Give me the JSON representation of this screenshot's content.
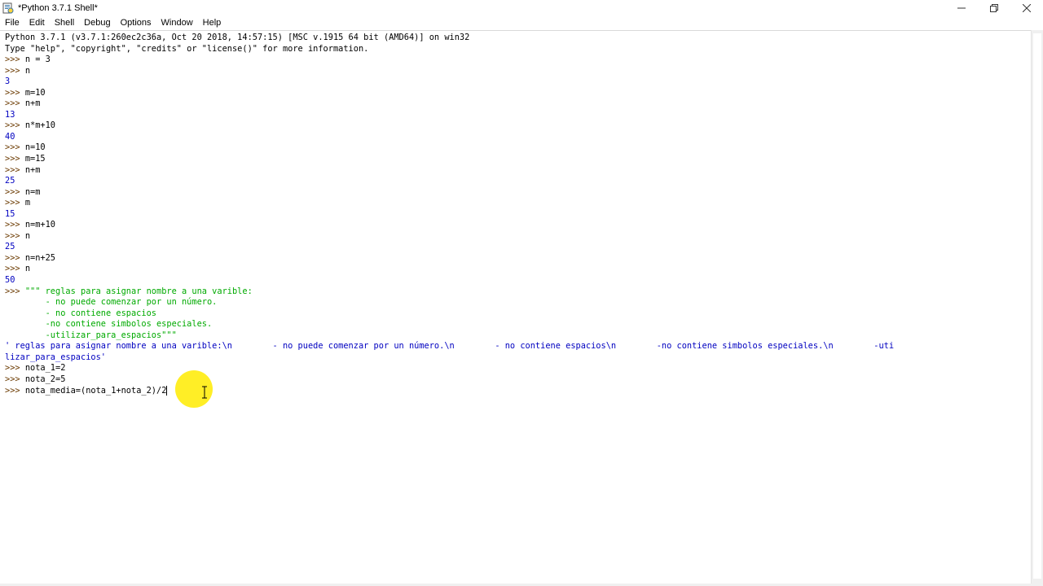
{
  "window": {
    "title": "*Python 3.7.1 Shell*",
    "controls": [
      "minimize",
      "restore",
      "close"
    ]
  },
  "menu": [
    "File",
    "Edit",
    "Shell",
    "Debug",
    "Options",
    "Window",
    "Help"
  ],
  "shell_lines": [
    {
      "t": "plain",
      "p": "",
      "c": "Python 3.7.1 (v3.7.1:260ec2c36a, Oct 20 2018, 14:57:15) [MSC v.1915 64 bit (AMD64)] on win32"
    },
    {
      "t": "plain",
      "p": "",
      "c": "Type \"help\", \"copyright\", \"credits\" or \"license()\" for more information."
    },
    {
      "t": "in",
      "p": ">>> ",
      "c": "n = 3"
    },
    {
      "t": "in",
      "p": ">>> ",
      "c": "n"
    },
    {
      "t": "out",
      "p": "",
      "c": "3"
    },
    {
      "t": "in",
      "p": ">>> ",
      "c": "m=10"
    },
    {
      "t": "in",
      "p": ">>> ",
      "c": "n+m"
    },
    {
      "t": "out",
      "p": "",
      "c": "13"
    },
    {
      "t": "in",
      "p": ">>> ",
      "c": "n*m+10"
    },
    {
      "t": "out",
      "p": "",
      "c": "40"
    },
    {
      "t": "in",
      "p": ">>> ",
      "c": "n=10"
    },
    {
      "t": "in",
      "p": ">>> ",
      "c": "m=15"
    },
    {
      "t": "in",
      "p": ">>> ",
      "c": "n+m"
    },
    {
      "t": "out",
      "p": "",
      "c": "25"
    },
    {
      "t": "in",
      "p": ">>> ",
      "c": "n=m"
    },
    {
      "t": "in",
      "p": ">>> ",
      "c": "m"
    },
    {
      "t": "out",
      "p": "",
      "c": "15"
    },
    {
      "t": "in",
      "p": ">>> ",
      "c": "n=m+10"
    },
    {
      "t": "in",
      "p": ">>> ",
      "c": "n"
    },
    {
      "t": "out",
      "p": "",
      "c": "25"
    },
    {
      "t": "in",
      "p": ">>> ",
      "c": "n=n+25"
    },
    {
      "t": "in",
      "p": ">>> ",
      "c": "n"
    },
    {
      "t": "out",
      "p": "",
      "c": "50"
    },
    {
      "t": "str",
      "p": ">>> ",
      "c": "\"\"\" reglas para asignar nombre a una varible:"
    },
    {
      "t": "str",
      "p": "",
      "c": "        - no puede comenzar por un número."
    },
    {
      "t": "str",
      "p": "",
      "c": "        - no contiene espacios"
    },
    {
      "t": "str",
      "p": "",
      "c": "        -no contiene simbolos especiales."
    },
    {
      "t": "str",
      "p": "",
      "c": "        -utilizar_para_espacios\"\"\""
    },
    {
      "t": "out",
      "p": "",
      "c": "' reglas para asignar nombre a una varible:\\n        - no puede comenzar por un número.\\n        - no contiene espacios\\n        -no contiene simbolos especiales.\\n        -uti"
    },
    {
      "t": "out",
      "p": "",
      "c": "lizar_para_espacios'"
    },
    {
      "t": "in",
      "p": ">>> ",
      "c": "nota_1=2"
    },
    {
      "t": "in",
      "p": ">>> ",
      "c": "nota_2=5"
    },
    {
      "t": "in",
      "p": ">>> ",
      "c": "nota_media=(nota_1+nota_2)/2"
    }
  ],
  "colors": {
    "prompt": "#6b3a00",
    "output": "#0000c0",
    "string": "#00aa00",
    "highlight": "#ffeb00"
  }
}
